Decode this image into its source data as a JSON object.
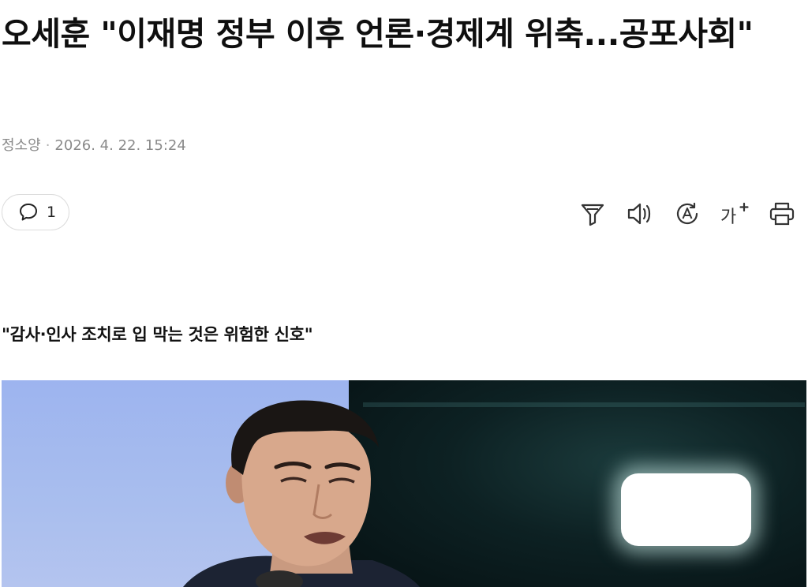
{
  "article": {
    "headline": "오세훈 \"이재명 정부 이후 언론·경제계 위축...공포사회\"",
    "author": "정소양",
    "separator": "·",
    "datetime": "2026. 4. 22. 15:24",
    "comment_count": "1",
    "subheadline": "\"감사·인사 조치로 입 막는 것은 위험한 신호\""
  },
  "toolbar": {
    "icons": [
      "summary-filter-icon",
      "text-to-speech-icon",
      "translate-icon",
      "font-size-icon",
      "print-icon"
    ],
    "font_size_glyph": "가"
  },
  "photo": {
    "subject": "speaker-photo"
  }
}
